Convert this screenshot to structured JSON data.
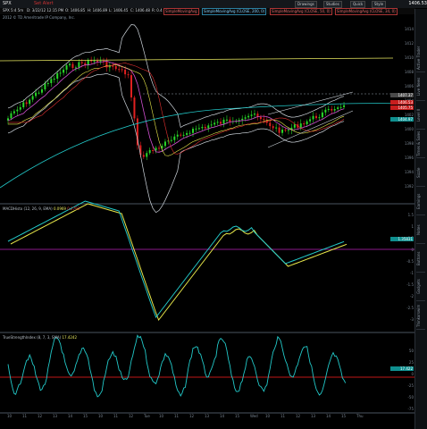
{
  "toolbar": {
    "symbol": "SPX",
    "alert_label": "Set Alert",
    "buttons": [
      "Drawings",
      "Studies",
      "Quick",
      "Style"
    ],
    "last_price": "1406.53"
  },
  "info": {
    "timeframe": "SPX 5:4 5m",
    "date": "D: 3/22/12 12:15 PM",
    "open": "O: 1406.85",
    "high": "H: 1406.89",
    "low": "L: 1406.45",
    "close": "C: 1406.48",
    "range": "R: 0.4",
    "studies": [
      {
        "label": "SimpleMovingAvg",
        "color": "#d050d0"
      },
      {
        "label": "SimpleMovingAvg (CLOSE, 200, 0)",
        "color": "#7fd0ff"
      },
      {
        "label": "SimpleMovingAvg (CLOSE, 50, 0)",
        "color": "#d050d0"
      },
      {
        "label": "SimpleMovingAvg (CLOSE, 34, 0)",
        "color": "#d050d0"
      }
    ]
  },
  "copyright": "2012 © TD Ameritrade IP Company, Inc.",
  "price_axis": [
    "1414",
    "1412",
    "1410",
    "1408",
    "1406",
    "1404",
    "1402",
    "1400",
    "1398",
    "1396",
    "1394",
    "1392"
  ],
  "price_tags": [
    {
      "text": "1407.37",
      "color": "#4a4a4a"
    },
    {
      "text": "1406.53",
      "color": "#c81e1e"
    },
    {
      "text": "1405.75",
      "color": "#c81e1e"
    },
    {
      "text": "1404.97",
      "color": "#0f8f8f"
    }
  ],
  "macd": {
    "title": "MACDHisto (12, 26, 9, EMA)",
    "value1": "0.0969",
    "value2": "0.2793",
    "axis": [
      "1.5",
      "1",
      "0.5",
      "0",
      "-0.5",
      "-1",
      "-1.5",
      "-2",
      "-2.5",
      "-3"
    ],
    "tag": "1.35831",
    "tag_color": "#0f8f8f"
  },
  "tsi": {
    "title": "TrueStrengthIndex (8, 7, 3, SMA)",
    "value": "17.4242",
    "axis": [
      "50",
      "25",
      "0",
      "-25",
      "-50",
      "-75"
    ],
    "tag": "17.422",
    "tag_color": "#0f8f8f"
  },
  "x_axis": [
    "10",
    "11",
    "12",
    "13",
    "14",
    "15",
    "10",
    "11",
    "12",
    "Tue",
    "10",
    "11",
    "12",
    "13",
    "14",
    "15",
    "Wed",
    "10",
    "11",
    "12",
    "13",
    "14",
    "15",
    "Thu"
  ],
  "side_tabs": [
    "Active Trader",
    "Live News",
    "Level II",
    "Times & Sales",
    "Sizzle",
    "Earnings",
    "Notes",
    "Buttons",
    "Gadgets",
    "Thinkorswim"
  ],
  "colors": {
    "up_candle": "#29d729",
    "down_candle": "#e02020",
    "macd_line": "#22c9c9",
    "macd_signal": "#e8e84a",
    "zero_line": "#8a1a8a",
    "tsi_line": "#22c9c9",
    "tsi_zero": "#c01818"
  }
}
